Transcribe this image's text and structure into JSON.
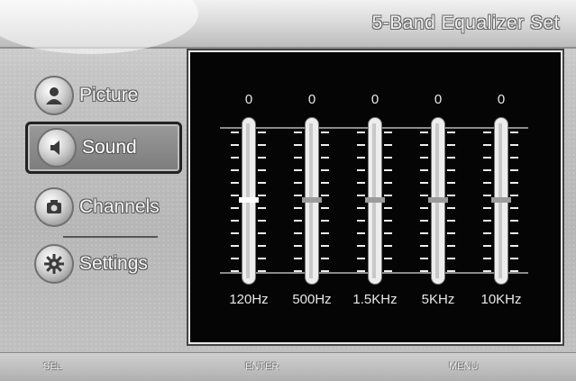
{
  "header": {
    "title": "5-Band Equalizer Set"
  },
  "menu": {
    "items": [
      {
        "label": "Picture",
        "icon": "person-icon"
      },
      {
        "label": "Sound",
        "icon": "speaker-icon"
      },
      {
        "label": "Channels",
        "icon": "camera-icon"
      },
      {
        "label": "Settings",
        "icon": "gear-icon"
      }
    ],
    "selected_index": 1
  },
  "equalizer": {
    "bands": [
      {
        "freq": "120Hz",
        "value": "0"
      },
      {
        "freq": "500Hz",
        "value": "0"
      },
      {
        "freq": "1.5KHz",
        "value": "0"
      },
      {
        "freq": "5KHz",
        "value": "0"
      },
      {
        "freq": "10KHz",
        "value": "0"
      }
    ],
    "active_band_index": 0
  },
  "footer": {
    "left": "SEL",
    "center": "ENTER",
    "right": "MENU"
  },
  "colors": {
    "panel_bg": "#050505",
    "panel_border": "#e8e8e8",
    "selected_border": "#222222"
  }
}
